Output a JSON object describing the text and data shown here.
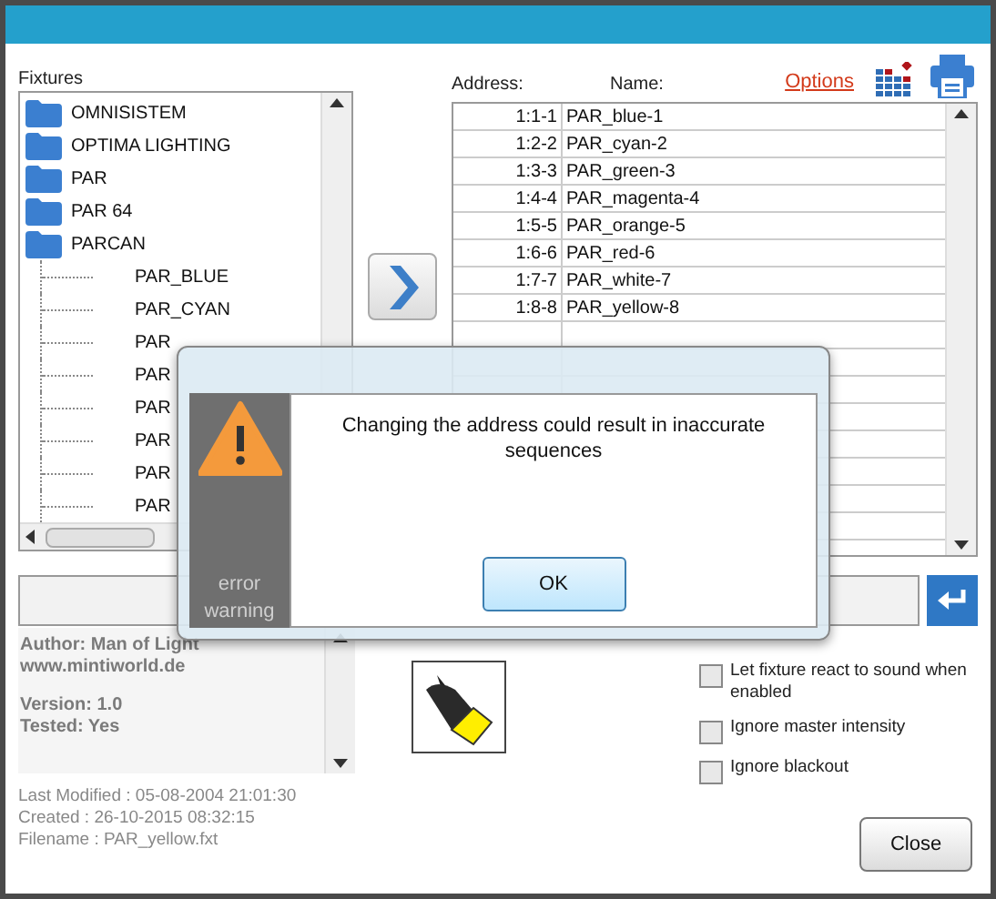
{
  "fixtures": {
    "label": "Fixtures",
    "tree": [
      {
        "name": "OMNISISTEM"
      },
      {
        "name": "OPTIMA LIGHTING"
      },
      {
        "name": "PAR"
      },
      {
        "name": "PAR 64"
      },
      {
        "name": "PARCAN",
        "children": [
          {
            "name": "PAR_BLUE"
          },
          {
            "name": "PAR_CYAN"
          },
          {
            "name": "PAR"
          },
          {
            "name": "PAR"
          },
          {
            "name": "PAR"
          },
          {
            "name": "PAR"
          },
          {
            "name": "PAR"
          },
          {
            "name": "PAR"
          }
        ]
      }
    ]
  },
  "patch": {
    "columns": [
      "Address:",
      "Name:"
    ],
    "options_link": "Options",
    "rows": [
      {
        "address": "1:1-1",
        "name": "PAR_blue-1"
      },
      {
        "address": "1:2-2",
        "name": "PAR_cyan-2"
      },
      {
        "address": "1:3-3",
        "name": "PAR_green-3"
      },
      {
        "address": "1:4-4",
        "name": "PAR_magenta-4"
      },
      {
        "address": "1:5-5",
        "name": "PAR_orange-5"
      },
      {
        "address": "1:6-6",
        "name": "PAR_red-6"
      },
      {
        "address": "1:7-7",
        "name": "PAR_white-7"
      },
      {
        "address": "1:8-8",
        "name": "PAR_yellow-8"
      }
    ]
  },
  "info": {
    "paragraphs": [
      [
        "Author: Man of Light",
        "www.mintiworld.de"
      ],
      [
        "Version: 1.0",
        "Tested: Yes"
      ]
    ]
  },
  "options": [
    {
      "label": "Let fixture react to sound when enabled",
      "checked": false
    },
    {
      "label": "Ignore master intensity",
      "checked": false
    },
    {
      "label": "Ignore blackout",
      "checked": false
    }
  ],
  "file_info": [
    "Last Modified : 05-08-2004 21:01:30",
    "Created : 26-10-2015 08:32:15",
    "Filename : PAR_yellow.fxt"
  ],
  "close_button": "Close",
  "dialog": {
    "side_label": "error warning",
    "message": "Changing the address could result in inaccurate sequences",
    "ok_button": "OK"
  }
}
